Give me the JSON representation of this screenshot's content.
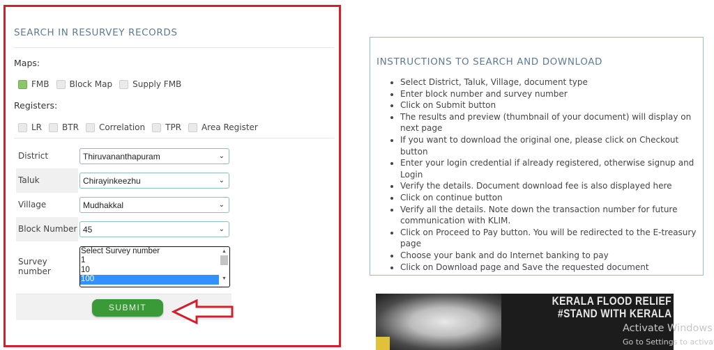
{
  "search": {
    "title": "SEARCH IN RESURVEY RECORDS",
    "maps_label": "Maps:",
    "maps": [
      {
        "label": "FMB",
        "checked": true
      },
      {
        "label": "Block Map",
        "checked": false
      },
      {
        "label": "Supply FMB",
        "checked": false
      }
    ],
    "registers_label": "Registers:",
    "registers": [
      {
        "label": "LR",
        "checked": false
      },
      {
        "label": "BTR",
        "checked": false
      },
      {
        "label": "Correlation",
        "checked": false
      },
      {
        "label": "TPR",
        "checked": false
      },
      {
        "label": "Area Register",
        "checked": false
      }
    ],
    "fields": {
      "district": {
        "label": "District",
        "value": "Thiruvananthapuram"
      },
      "taluk": {
        "label": "Taluk",
        "value": "Chirayinkeezhu"
      },
      "village": {
        "label": "Village",
        "value": "Mudhakkal"
      },
      "block": {
        "label": "Block Number",
        "value": "45"
      }
    },
    "survey": {
      "label": "Survey number",
      "options": [
        "Select Survey number",
        "1",
        "10",
        "100"
      ],
      "selected": "100"
    },
    "submit_label": "SUBMIT",
    "accent_color": "#3a9a38",
    "highlight_color": "#d21f2b"
  },
  "instructions": {
    "title": "INSTRUCTIONS TO SEARCH AND DOWNLOAD",
    "items": [
      "Select District, Taluk, Village, document type",
      "Enter block number and survey number",
      "Click on Submit button",
      "The results and preview (thumbnail of your document) will display on next page",
      "If you want to download the original one, please click on Checkout button",
      "Enter your login credential if already registered, otherwise signup and Login",
      "Verify the details. Document download fee is also displayed here",
      "Click on continue button",
      "Verify all the details. Note down the transaction number for future communication with KLIM.",
      "Click on Proceed to Pay button. You will be redirected to the E-treasury page",
      "Choose your bank and do Internet banking to pay",
      "Click on Download page and Save the requested document"
    ]
  },
  "banner": {
    "line1": "KERALA FLOOD RELIEF",
    "line2": "#STAND WITH KERALA"
  },
  "watermark": {
    "line1": "Activate Windows",
    "line2": "Go to Settings to activate Windows."
  }
}
